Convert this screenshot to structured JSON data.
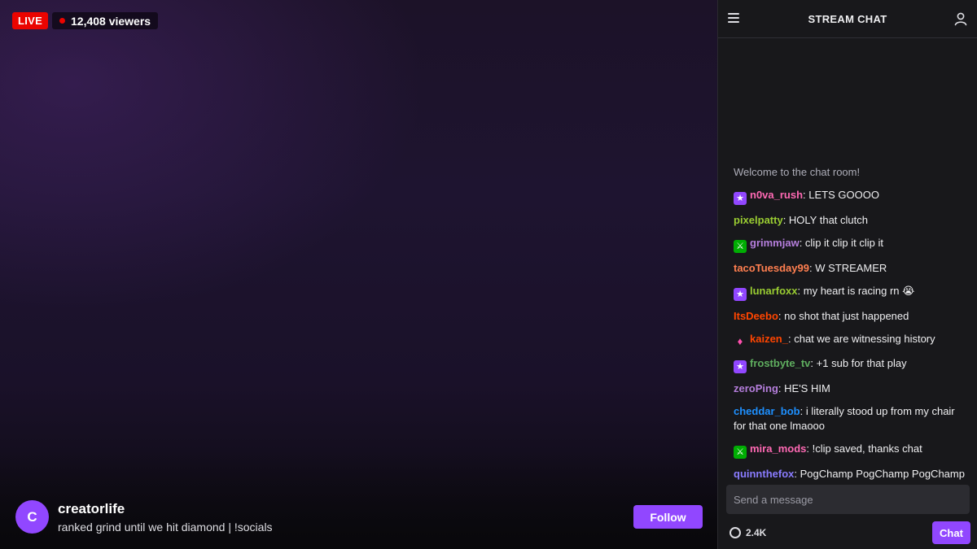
{
  "stream": {
    "live_label": "LIVE",
    "viewers": "12,408 viewers",
    "streamer": {
      "avatar_letter": "C",
      "name": "creatorlife",
      "title": "ranked grind until we hit diamond | !socials"
    },
    "follow_label": "Follow"
  },
  "chat": {
    "header_title": "STREAM CHAT",
    "welcome": "Welcome to the chat room!",
    "messages": [
      {
        "badge": "sub",
        "user": "n0va_rush",
        "color": "#ff69b4",
        "text": "LETS GOOOO"
      },
      {
        "badge": "",
        "user": "pixelpatty",
        "color": "#9acd32",
        "text": "HOLY that clutch"
      },
      {
        "badge": "mod",
        "user": "grimmjaw",
        "color": "#b57edc",
        "text": "clip it clip it clip it"
      },
      {
        "badge": "",
        "user": "tacoTuesday99",
        "color": "#ff7f50",
        "text": "W STREAMER"
      },
      {
        "badge": "sub",
        "user": "lunarfoxx",
        "color": "#9acd32",
        "text": "my heart is racing rn 😭"
      },
      {
        "badge": "",
        "user": "ItsDeebo",
        "color": "#ff4500",
        "text": "no shot that just happened"
      },
      {
        "badge": "gem",
        "user": "kaizen_",
        "color": "#ff4500",
        "text": "chat we are witnessing history"
      },
      {
        "badge": "sub",
        "user": "frostbyte_tv",
        "color": "#5fae5f",
        "text": "+1 sub for that play"
      },
      {
        "badge": "",
        "user": "zeroPing",
        "color": "#b57edc",
        "text": "HE'S HIM"
      },
      {
        "badge": "",
        "user": "cheddar_bob",
        "color": "#1e90ff",
        "text": "i literally stood up from my chair for that one lmaooo"
      },
      {
        "badge": "mod",
        "user": "mira_mods",
        "color": "#ff69b4",
        "text": "!clip saved, thanks chat"
      },
      {
        "badge": "",
        "user": "quinnthefox",
        "color": "#8a7cff",
        "text": "PogChamp PogChamp PogChamp"
      }
    ],
    "input_placeholder": "Send a message",
    "points": "2.4K",
    "send_label": "Chat"
  },
  "colors": {
    "live": "#eb0400",
    "accent": "#9147ff",
    "chat_bg": "#18181b"
  },
  "icons": {
    "menu": "menu-icon",
    "user": "user-icon",
    "sub_badge": "star-icon",
    "mod_badge": "sword-icon",
    "gem_badge": "gem-icon",
    "points": "channel-points-icon"
  }
}
